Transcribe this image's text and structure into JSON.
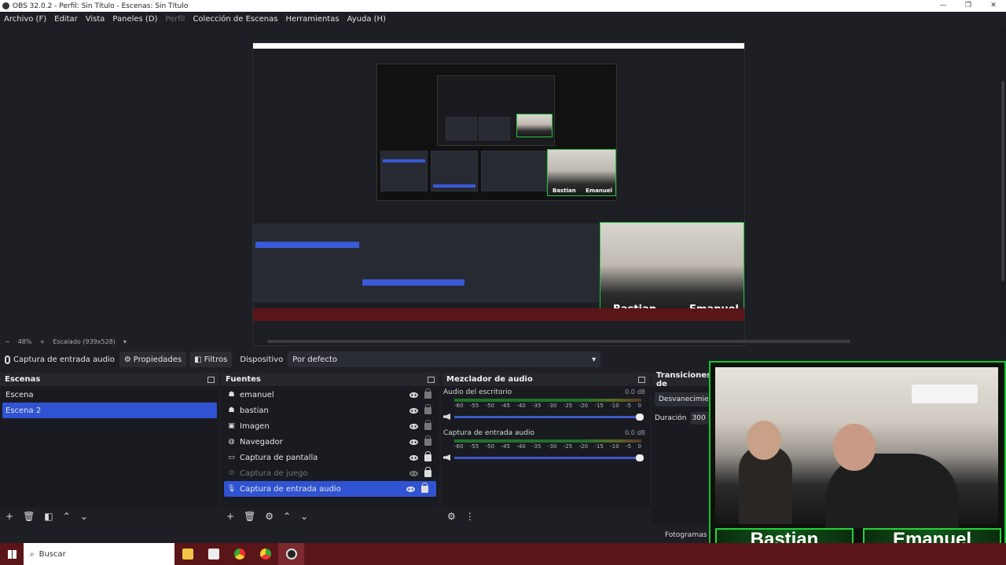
{
  "window": {
    "title": "OBS 32.0.2 - Perfil: Sin Título - Escenas: Sin Título",
    "controls": [
      "—",
      "❐",
      "✕"
    ]
  },
  "menu": {
    "items": [
      "Archivo (F)",
      "Editar",
      "Vista",
      "Paneles (D)",
      "Perfil",
      "Colección de Escenas",
      "Herramientas",
      "Ayuda (H)"
    ]
  },
  "preview": {
    "zoom": "48%",
    "scale_label": "Escalado (939x528)",
    "nested_names": [
      "Bastian",
      "Emanuel"
    ]
  },
  "properties_bar": {
    "source_label": "Captura de entrada audio",
    "properties_button": "Propiedades",
    "filters_button": "Filtros",
    "device_label": "Dispositivo",
    "device_value": "Por defecto"
  },
  "scenes": {
    "title": "Escenas",
    "items": [
      "Escena",
      "Escena 2"
    ],
    "selected": "Escena 2"
  },
  "sources": {
    "title": "Fuentes",
    "items": [
      {
        "name": "emanuel",
        "icon": "group-icon",
        "visible": true,
        "locked": false
      },
      {
        "name": "bastian",
        "icon": "group-icon",
        "visible": true,
        "locked": false
      },
      {
        "name": "Imagen",
        "icon": "image-icon",
        "visible": true,
        "locked": false
      },
      {
        "name": "Navegador",
        "icon": "globe-icon",
        "visible": true,
        "locked": false
      },
      {
        "name": "Captura de pantalla",
        "icon": "monitor-icon",
        "visible": true,
        "locked": true
      },
      {
        "name": "Captura de juego",
        "icon": "gamepad-icon",
        "visible": false,
        "locked": true
      },
      {
        "name": "Captura de entrada audio",
        "icon": "mic-icon",
        "visible": true,
        "locked": true
      }
    ]
  },
  "mixer": {
    "title": "Mezclador de audio",
    "channels": [
      {
        "name": "Audio del escritorio",
        "db": "0.0 dB",
        "level": 0.0
      },
      {
        "name": "Captura de entrada audio",
        "db": "0.0 dB",
        "level": 0.0
      }
    ],
    "scale": [
      "-60",
      "-55",
      "-50",
      "-45",
      "-40",
      "-35",
      "-30",
      "-25",
      "-20",
      "-15",
      "-10",
      "-5",
      "0"
    ]
  },
  "transitions": {
    "title": "Transiciones de",
    "selected": "Desvanecimiento",
    "duration_label": "Duración",
    "duration_value": "300"
  },
  "status": {
    "fps_label": "Fotogramas P"
  },
  "webcam": {
    "left_name": "Bastian",
    "right_name": "Emanuel"
  },
  "taskbar": {
    "search_placeholder": "Buscar",
    "accent": "#5a1518"
  }
}
